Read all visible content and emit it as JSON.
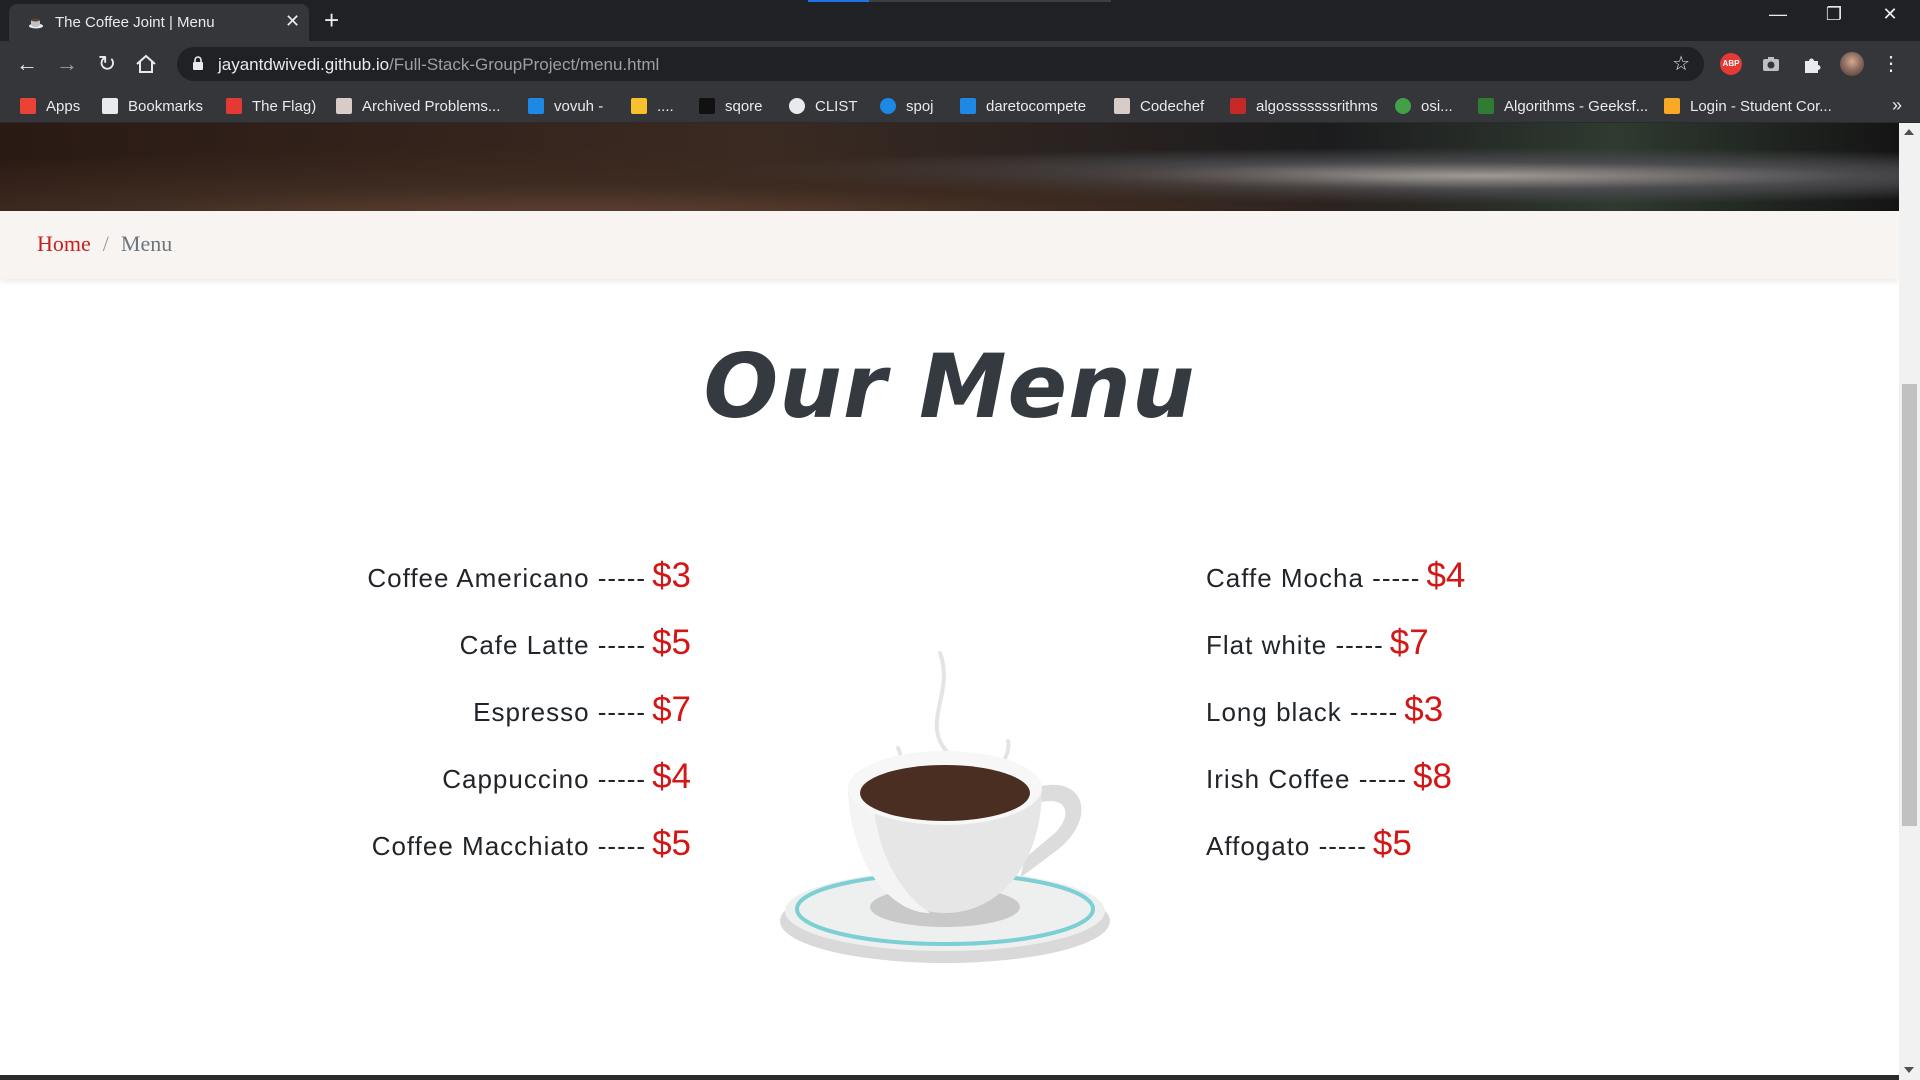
{
  "browser": {
    "tab_title": "The Coffee Joint | Menu",
    "tab_close": "✕",
    "new_tab": "+",
    "url_host": "jayantdwivedi.github.io",
    "url_path": "/Full-Stack-GroupProject/menu.html",
    "abp_label": "ABP",
    "bookmarks": [
      {
        "label": "Apps",
        "icon": "apps-grid-icon",
        "color": "#ea4335"
      },
      {
        "label": "Bookmarks",
        "icon": "star-icon",
        "color": "#e8eaed"
      },
      {
        "label": "The Flag)",
        "icon": "flag-icon",
        "color": "#e53935"
      },
      {
        "label": "Archived Problems...",
        "icon": "archive-icon",
        "color": "#d7ccc8"
      },
      {
        "label": "vovuh -",
        "icon": "codeforces-icon",
        "color": "#1e88e5"
      },
      {
        "label": "....",
        "icon": "codeforces-icon",
        "color": "#fbc02d"
      },
      {
        "label": "sqore",
        "icon": "sqore-icon",
        "color": "#111111"
      },
      {
        "label": "CLIST",
        "icon": "globe-icon",
        "color": "#e8eaed"
      },
      {
        "label": "spoj",
        "icon": "spoj-icon",
        "color": "#1e88e5"
      },
      {
        "label": "daretocompete",
        "icon": "dare-icon",
        "color": "#1e88e5"
      },
      {
        "label": "Codechef",
        "icon": "codechef-icon",
        "color": "#d7ccc8"
      },
      {
        "label": "algosssssssrithms",
        "icon": "search-q-icon",
        "color": "#c62828"
      },
      {
        "label": "osi...",
        "icon": "github-icon",
        "color": "#43a047"
      },
      {
        "label": "Algorithms - Geeksf...",
        "icon": "gfg-icon",
        "color": "#2e7d32"
      },
      {
        "label": "Login - Student Cor...",
        "icon": "student-icon",
        "color": "#f9a825"
      }
    ]
  },
  "page": {
    "breadcrumb": {
      "home": "Home",
      "separator": "/",
      "current": "Menu"
    },
    "title": "Our Menu",
    "left_items": [
      {
        "name": "Coffee Americano -----",
        "price": "$3"
      },
      {
        "name": "Cafe Latte -----",
        "price": "$5"
      },
      {
        "name": "Espresso -----",
        "price": "$7"
      },
      {
        "name": "Cappuccino -----",
        "price": "$4"
      },
      {
        "name": "Coffee Macchiato -----",
        "price": "$5"
      }
    ],
    "right_items": [
      {
        "name": "Caffe Mocha -----",
        "price": "$4"
      },
      {
        "name": "Flat white -----",
        "price": "$7"
      },
      {
        "name": "Long black -----",
        "price": "$3"
      },
      {
        "name": "Irish Coffee -----",
        "price": "$8"
      },
      {
        "name": "Affogato -----",
        "price": "$5"
      }
    ],
    "price_color": "#d31616",
    "link_color": "#c81e1e"
  }
}
